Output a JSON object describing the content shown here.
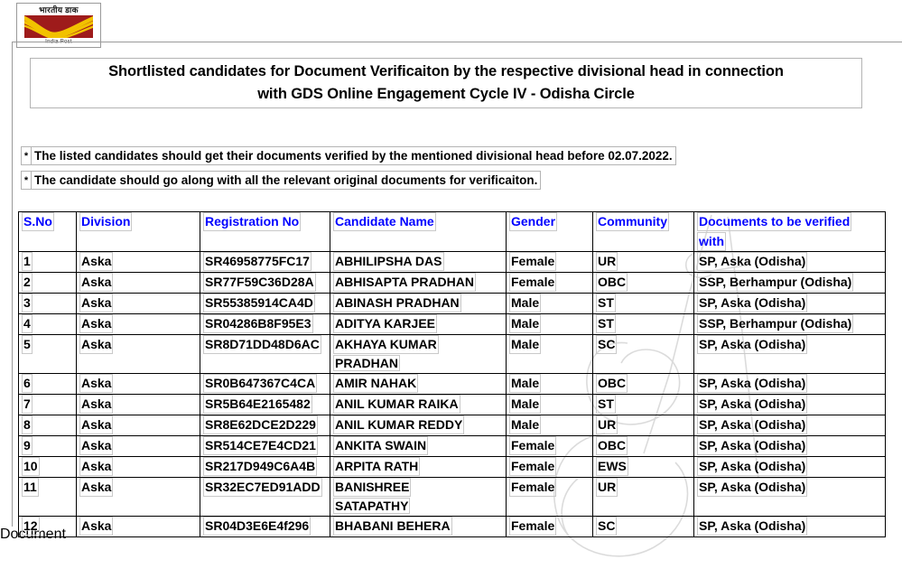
{
  "logo": {
    "name": "india-post-logo",
    "hindi_text": "भारतीय डाक",
    "caption": "India Post",
    "red": "#9e1b1b",
    "gold": "#f2c200"
  },
  "title": {
    "line1": "Shortlisted candidates for Document Verificaiton by the respective divisional head in connection",
    "line2": "with GDS Online Engagement Cycle IV - Odisha Circle"
  },
  "notes": [
    {
      "marker": "*",
      "text": "The listed candidates should get their documents verified by the mentioned divisional head before 02.07.2022."
    },
    {
      "marker": "*",
      "text": "The candidate should go along with all the relevant original documents for verificaiton."
    }
  ],
  "table": {
    "headers": {
      "sno": "S.No",
      "division": "Division",
      "registration": "Registration No",
      "name": "Candidate Name",
      "gender": "Gender",
      "community": "Community",
      "documents_line1": "Documents to be verified",
      "documents_line2": "with"
    },
    "header_color": "#0000ff",
    "rows": [
      {
        "sno": "1",
        "division": "Aska",
        "registration": "SR46958775FC17",
        "name": "ABHILIPSHA DAS",
        "name2": "",
        "gender": "Female",
        "community": "UR",
        "documents": "SP, Aska (Odisha)"
      },
      {
        "sno": "2",
        "division": "Aska",
        "registration": "SR77F59C36D28A",
        "name": "ABHISAPTA PRADHAN",
        "name2": "",
        "gender": "Female",
        "community": "OBC",
        "documents": "SSP, Berhampur (Odisha)"
      },
      {
        "sno": "3",
        "division": "Aska",
        "registration": "SR55385914CA4D",
        "name": "ABINASH PRADHAN",
        "name2": "",
        "gender": "Male",
        "community": "ST",
        "documents": "SP, Aska (Odisha)"
      },
      {
        "sno": "4",
        "division": "Aska",
        "registration": "SR04286B8F95E3",
        "name": "ADITYA KARJEE",
        "name2": "",
        "gender": "Male",
        "community": "ST",
        "documents": "SSP, Berhampur (Odisha)"
      },
      {
        "sno": "5",
        "division": "Aska",
        "registration": "SR8D71DD48D6AC",
        "name": "AKHAYA KUMAR",
        "name2": "PRADHAN",
        "gender": "Male",
        "community": "SC",
        "documents": "SP, Aska (Odisha)"
      },
      {
        "sno": "6",
        "division": "Aska",
        "registration": "SR0B647367C4CA",
        "name": "AMIR NAHAK",
        "name2": "",
        "gender": "Male",
        "community": "OBC",
        "documents": "SP, Aska (Odisha)"
      },
      {
        "sno": "7",
        "division": "Aska",
        "registration": "SR5B64E2165482",
        "name": "ANIL KUMAR RAIKA",
        "name2": "",
        "gender": "Male",
        "community": "ST",
        "documents": "SP, Aska (Odisha)"
      },
      {
        "sno": "8",
        "division": "Aska",
        "registration": "SR8E62DCE2D229",
        "name": "ANIL KUMAR REDDY",
        "name2": "",
        "gender": "Male",
        "community": "UR",
        "documents": "SP, Aska (Odisha)"
      },
      {
        "sno": "9",
        "division": "Aska",
        "registration": "SR514CE7E4CD21",
        "name": "ANKITA SWAIN",
        "name2": "",
        "gender": "Female",
        "community": "OBC",
        "documents": "SP, Aska (Odisha)"
      },
      {
        "sno": "10",
        "division": "Aska",
        "registration": "SR217D949C6A4B",
        "name": "ARPITA RATH",
        "name2": "",
        "gender": "Female",
        "community": "EWS",
        "documents": "SP, Aska (Odisha)"
      },
      {
        "sno": "11",
        "division": "Aska",
        "registration": "SR32EC7ED91ADD",
        "name": "BANISHREE",
        "name2": "SATAPATHY",
        "gender": "Female",
        "community": "UR",
        "documents": "SP, Aska (Odisha)"
      },
      {
        "sno": "12",
        "division": "Aska",
        "registration": "SR04D3E6E4f296",
        "name": "BHABANI BEHERA",
        "name2": "",
        "gender": "Female",
        "community": "SC",
        "documents": "SP, Aska (Odisha)"
      }
    ]
  }
}
